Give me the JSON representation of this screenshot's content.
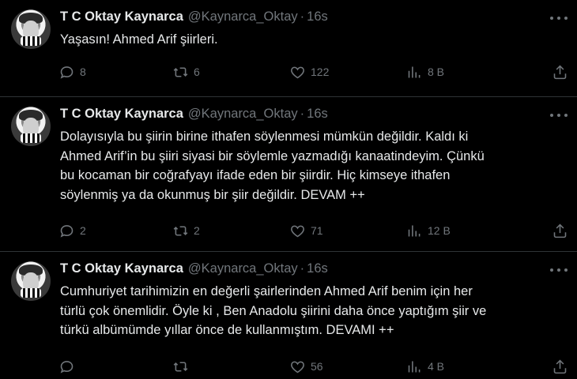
{
  "tweets": [
    {
      "name": "T C Oktay Kaynarca",
      "handle": "@Kaynarca_Oktay",
      "separator": "·",
      "time": "16s",
      "text": "Yaşasın! Ahmed Arif şiirleri.",
      "replies": "8",
      "retweets": "6",
      "likes": "122",
      "views": "8 B"
    },
    {
      "name": "T C Oktay Kaynarca",
      "handle": "@Kaynarca_Oktay",
      "separator": "·",
      "time": "16s",
      "text": "Dolayısıyla bu şiirin birine ithafen söylenmesi mümkün değildir. Kaldı ki\nAhmed Arif’in bu şiiri siyasi bir söylemle yazmadığı kanaatindeyim. Çünkü\nbu kocaman bir coğrafyayı ifade eden bir şiirdir. Hiç kimseye ithafen\nsöylenmiş ya da okunmuş bir şiir değildir. DEVAM ++",
      "replies": "2",
      "retweets": "2",
      "likes": "71",
      "views": "12 B"
    },
    {
      "name": "T C Oktay Kaynarca",
      "handle": "@Kaynarca_Oktay",
      "separator": "·",
      "time": "16s",
      "text": "Cumhuriyet tarihimizin en değerli şairlerinden Ahmed Arif benim için her\ntürlü çok önemlidir. Öyle ki , Ben Anadolu şiirini daha önce yaptığım şiir ve\ntürkü albümümde yıllar önce de kullanmıştım. DEVAMI ++",
      "replies": "",
      "retweets": "",
      "likes": "56",
      "views": "4 B"
    }
  ],
  "icons": {
    "reply": "speech-bubble-icon",
    "retweet": "retweet-arrows-icon",
    "like": "heart-icon",
    "views": "bar-chart-icon",
    "share": "share-upload-icon",
    "more": "ellipsis-icon"
  },
  "colors": {
    "background": "#000000",
    "text": "#e7e9ea",
    "muted": "#71767b",
    "divider": "#2f3336"
  }
}
